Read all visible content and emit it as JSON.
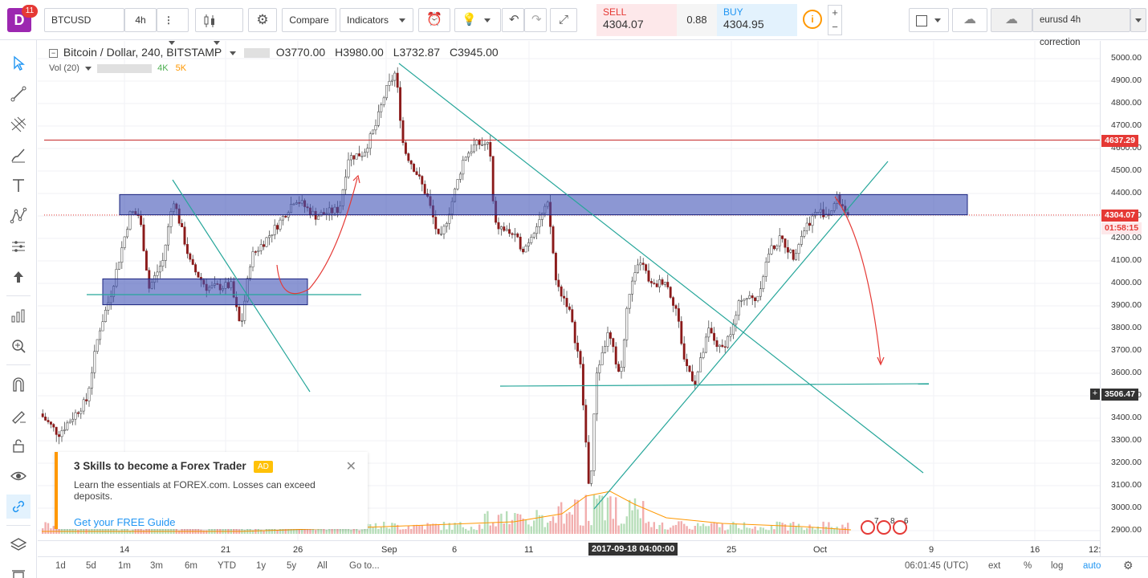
{
  "logo": {
    "letter": "D",
    "badge": "11"
  },
  "toolbar": {
    "symbol": "BTCUSD",
    "interval": "4h",
    "compare": "Compare",
    "indicators": "Indicators",
    "sell_label": "SELL",
    "sell_price": "4304.07",
    "spread": "0.88",
    "buy_label": "BUY",
    "buy_price": "4304.95",
    "layout_name": "eurusd 4h correction"
  },
  "legend": {
    "title": "Bitcoin / Dollar, 240, BITSTAMP",
    "open": "O3770.00",
    "high": "H3980.00",
    "low": "L3732.87",
    "close": "C3945.00"
  },
  "volume_legend": {
    "label": "Vol (20)",
    "v1": "4K",
    "v2": "5K"
  },
  "price_axis": {
    "labels": [
      "5000.00",
      "4900.00",
      "4800.00",
      "4700.00",
      "4600.00",
      "4500.00",
      "4400.00",
      "4300.00",
      "4200.00",
      "4100.00",
      "4000.00",
      "3900.00",
      "3800.00",
      "3700.00",
      "3600.00",
      "3500.00",
      "3400.00",
      "3300.00",
      "3200.00",
      "3100.00",
      "3000.00",
      "2900.00"
    ],
    "tag_resistance": "4637.29",
    "tag_last": "4304.07",
    "tag_countdown": "01:58:15",
    "tag_cursor": "3506.47"
  },
  "time_axis": {
    "labels": [
      "14",
      "21",
      "26",
      "Sep",
      "6",
      "11",
      "25",
      "Oct",
      "9",
      "16",
      "12:"
    ],
    "cursor_label": "2017-09-18 04:00:00"
  },
  "bottom_bar": {
    "ranges": [
      "1d",
      "5d",
      "1m",
      "3m",
      "6m",
      "YTD",
      "1y",
      "5y",
      "All"
    ],
    "goto": "Go to...",
    "clock": "06:01:45 (UTC)",
    "ext": "ext",
    "percent": "%",
    "log": "log",
    "auto": "auto"
  },
  "ad": {
    "title": "3 Skills to become a Forex Trader",
    "badge": "AD",
    "body": "Learn the essentials at FOREX.com. Losses can exceed deposits.",
    "link": "Get your FREE Guide"
  },
  "events": {
    "e1": "7",
    "e2": "8",
    "e3": "6"
  },
  "colors": {
    "up": "#4caf50",
    "down": "#8b1a1a",
    "zone": "#3f51b5",
    "trend": "#26a69a",
    "arrow": "#e53935",
    "resistance": "#c62828"
  }
}
